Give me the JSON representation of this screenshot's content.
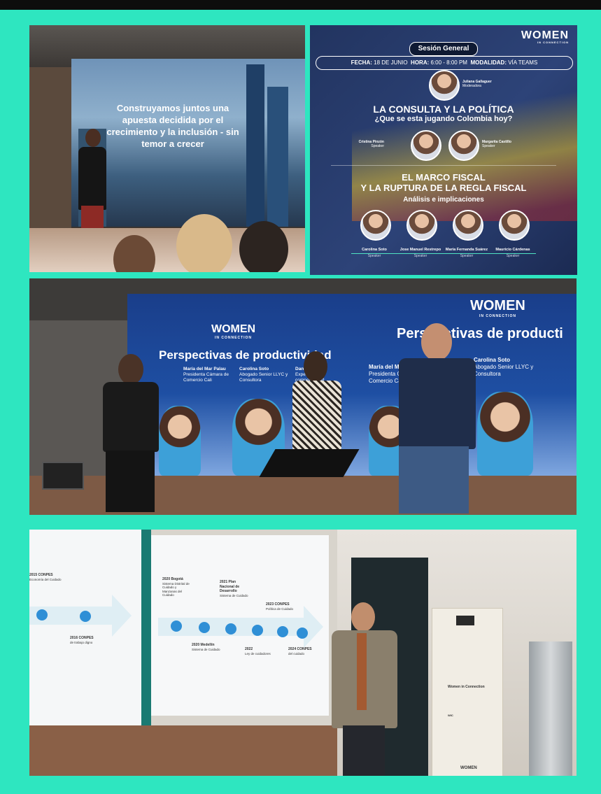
{
  "photo1": {
    "slide_text": "Construyamos juntos una apuesta decidida por el crecimiento y la inclusión - sin temor a crecer"
  },
  "poster": {
    "logo": "WOMEN",
    "logo_sub": "IN CONNECTION",
    "session": "Sesión General",
    "date_line": {
      "fecha_label": "FECHA:",
      "fecha": "18 DE JUNIO",
      "hora_label": "HORA:",
      "hora": "6:00 - 8:00 PM",
      "modalidad_label": "MODALIDAD:",
      "modalidad": "VÍA TEAMS"
    },
    "moderator": {
      "name": "Juliana Gallaguer",
      "role": "Moderadora"
    },
    "panel1_title": "LA CONSULTA Y LA POLÍTICA",
    "panel1_subtitle": "¿Que se esta jugando Colombia hoy?",
    "panel1_speakers": [
      {
        "name": "Cristina Pinzón",
        "role": "Speaker"
      },
      {
        "name": "Margarita Castillo",
        "role": "Speaker"
      }
    ],
    "panel2_title_1": "EL MARCO FISCAL",
    "panel2_title_2": "Y LA RUPTURA DE LA REGLA FISCAL",
    "panel2_subtitle": "Análisis e implicaciones",
    "panel2_speakers": [
      {
        "name": "Carolina Soto",
        "role": "Speaker"
      },
      {
        "name": "Jose Manuel Restrepo",
        "role": "Speaker"
      },
      {
        "name": "María Fernanda Suárez",
        "role": "Speaker"
      },
      {
        "name": "Mauricio Cárdenas",
        "role": "Speaker"
      }
    ]
  },
  "photo3": {
    "logo": "WOMEN",
    "logo_sub": "IN CONNECTION",
    "title": "Perspectivas de productividad",
    "title_right": "Perspectivas de producti",
    "people": [
      {
        "name": "María del Mar Palau",
        "role": "Presidenta Cámara de Comercio Cali"
      },
      {
        "name": "Carolina Soto",
        "role": "Abogado Senior LLYC y Consultora"
      },
      {
        "name": "Daniel Gómez",
        "role": "Experto en competitividad"
      }
    ]
  },
  "photo4": {
    "timeline_left": [
      {
        "title": "2015 CONPES",
        "desc": "Economía del Cuidado"
      },
      {
        "title": "2016 CONPES",
        "desc": "de trabajo digno"
      }
    ],
    "timeline_right": [
      {
        "title": "2020 Bogotá",
        "desc": "Sistema Distrital de Cuidado y Manzanas del Cuidado"
      },
      {
        "title": "2020 Medellín",
        "desc": "Sistema de Cuidado"
      },
      {
        "title": "2021 Plan Nacional de Desarrollo",
        "desc": "Sistema de Cuidado"
      },
      {
        "title": "2022",
        "desc": "Ley de cuidadores"
      },
      {
        "title": "2023 CONPES",
        "desc": "Política de Cuidado"
      },
      {
        "title": "2024 CONPES",
        "desc": "del cuidado"
      }
    ],
    "banner_title": "Women in Connection",
    "banner_sub": "WIC",
    "banner_logo": "WOMEN"
  }
}
